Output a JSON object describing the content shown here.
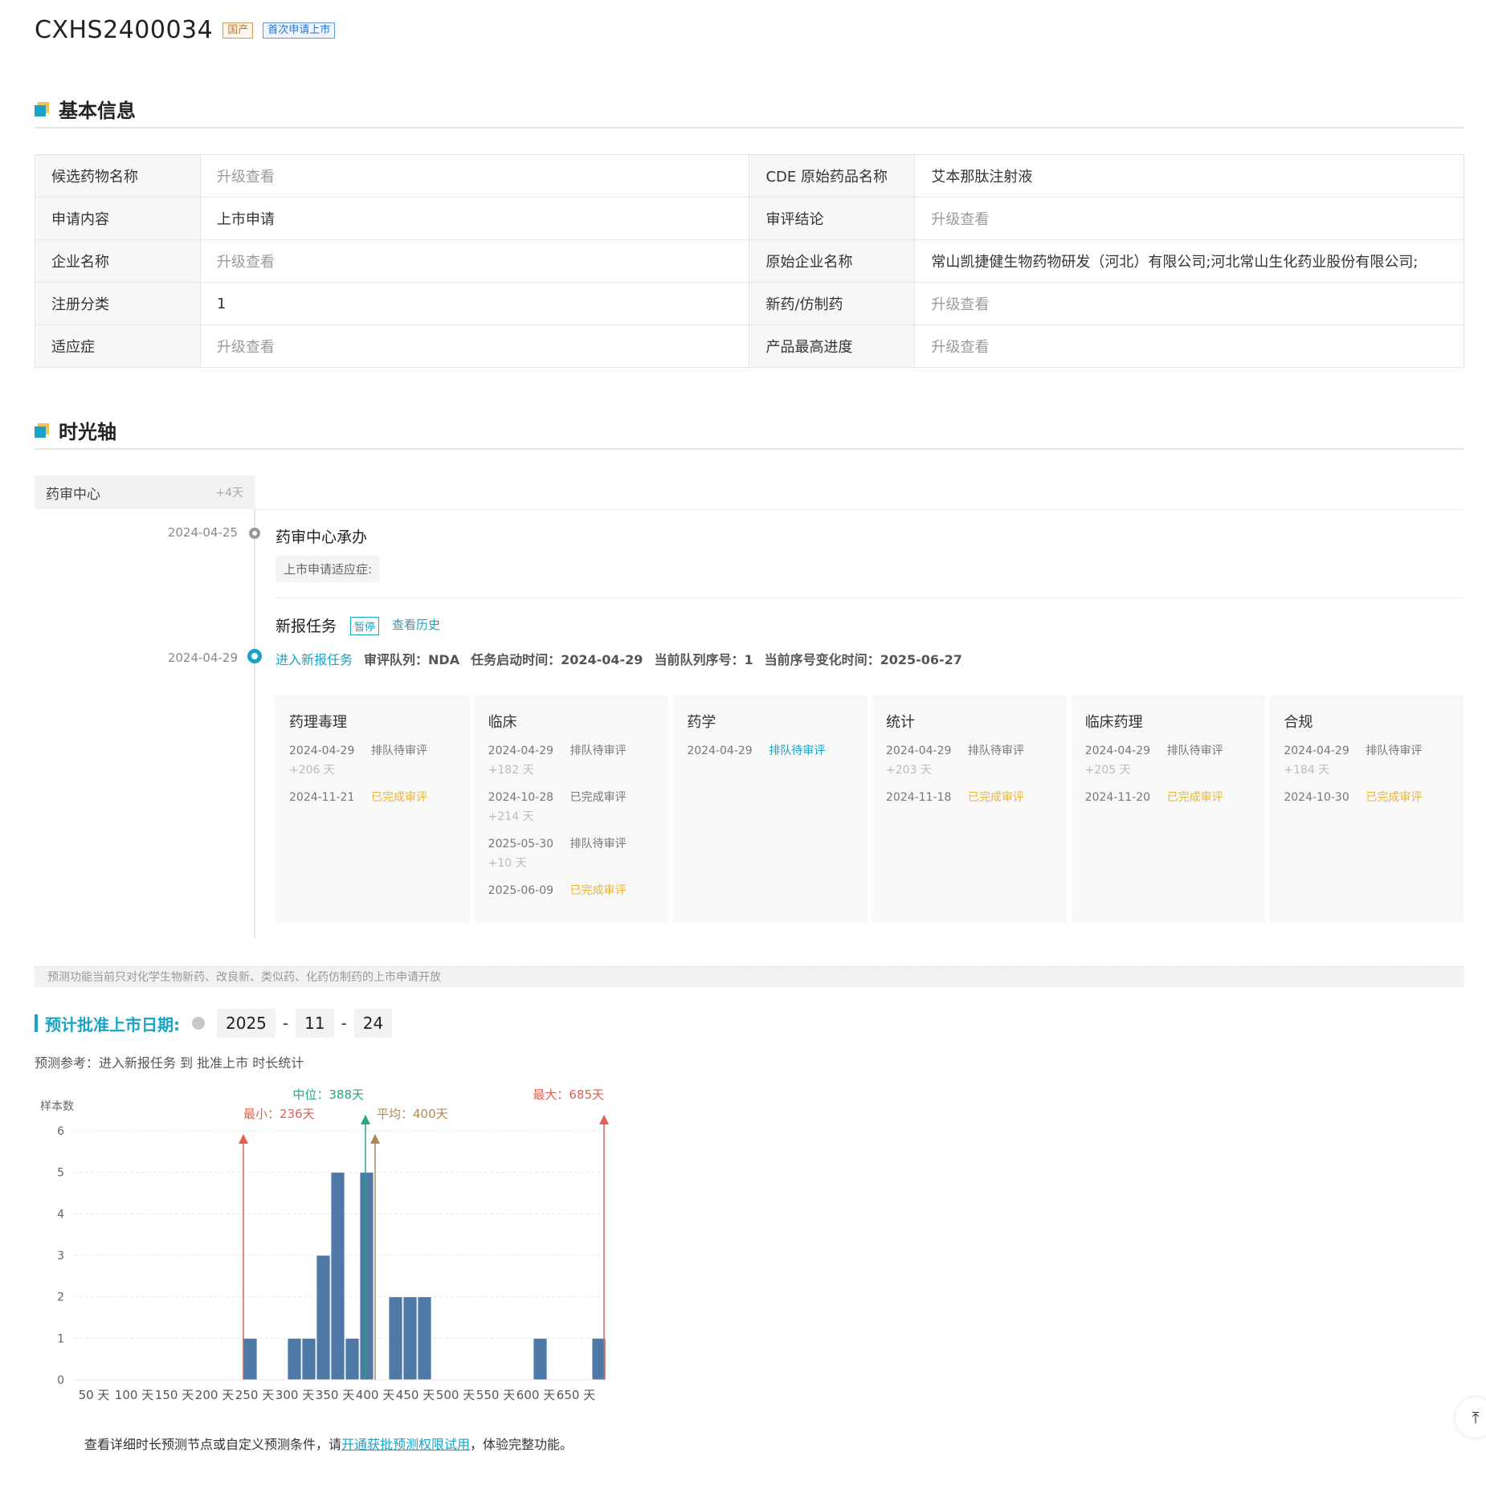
{
  "header": {
    "app_id": "CXHS2400034",
    "tag_origin": "国产",
    "tag_first": "首次申请上市"
  },
  "sections": {
    "basic": "基本信息",
    "timeline": "时光轴"
  },
  "info_table": {
    "rows": [
      {
        "l1": "候选药物名称",
        "v1": "升级查看",
        "l2": "CDE 原始药品名称",
        "v2": "艾本那肽注射液"
      },
      {
        "l1": "申请内容",
        "v1": "上市申请",
        "l2": "审评结论",
        "v2": "升级查看"
      },
      {
        "l1": "企业名称",
        "v1": "升级查看",
        "l2": "原始企业名称",
        "v2": "常山凯捷健生物药物研发（河北）有限公司;河北常山生化药业股份有限公司;"
      },
      {
        "l1": "注册分类",
        "v1": "1",
        "l2": "新药/仿制药",
        "v2": "升级查看"
      },
      {
        "l1": "适应症",
        "v1": "升级查看",
        "l2": "产品最高进度",
        "v2": "升级查看"
      }
    ]
  },
  "timeline": {
    "org": "药审中心",
    "org_days": "+4天",
    "event1": {
      "date": "2024-04-25",
      "title": "药审中心承办",
      "indication": "上市申请适应症:"
    },
    "event2": {
      "date": "2024-04-29",
      "title": "新报任务",
      "badge": "暂停",
      "history_link": "查看历史",
      "enter": "进入新报任务",
      "queue": "审评队列：NDA",
      "start": "任务启动时间：2024-04-29",
      "seq": "当前队列序号：1",
      "seq_change": "当前序号变化时间：2025-06-27"
    },
    "cards": [
      {
        "title": "药理毒理",
        "entries": [
          {
            "date": "2024-04-29",
            "status": "排队待审评",
            "kind": "q",
            "plus": "+206 天"
          },
          {
            "date": "2024-11-21",
            "status": "已完成审评",
            "kind": "done",
            "plus": ""
          }
        ]
      },
      {
        "title": "临床",
        "entries": [
          {
            "date": "2024-04-29",
            "status": "排队待审评",
            "kind": "q",
            "plus": "+182 天"
          },
          {
            "date": "2024-10-28",
            "status": "已完成审评",
            "kind": "q",
            "plus": "+214 天"
          },
          {
            "date": "2025-05-30",
            "status": "排队待审评",
            "kind": "q",
            "plus": "+10 天"
          },
          {
            "date": "2025-06-09",
            "status": "已完成审评",
            "kind": "done",
            "plus": ""
          }
        ]
      },
      {
        "title": "药学",
        "entries": [
          {
            "date": "2024-04-29",
            "status": "排队待审评",
            "kind": "qblue",
            "plus": ""
          }
        ]
      },
      {
        "title": "统计",
        "entries": [
          {
            "date": "2024-04-29",
            "status": "排队待审评",
            "kind": "q",
            "plus": "+203 天"
          },
          {
            "date": "2024-11-18",
            "status": "已完成审评",
            "kind": "done",
            "plus": ""
          }
        ]
      },
      {
        "title": "临床药理",
        "entries": [
          {
            "date": "2024-04-29",
            "status": "排队待审评",
            "kind": "q",
            "plus": "+205 天"
          },
          {
            "date": "2024-11-20",
            "status": "已完成审评",
            "kind": "done",
            "plus": ""
          }
        ]
      },
      {
        "title": "合规",
        "entries": [
          {
            "date": "2024-04-29",
            "status": "排队待审评",
            "kind": "q",
            "plus": "+184 天"
          },
          {
            "date": "2024-10-30",
            "status": "已完成审评",
            "kind": "done",
            "plus": ""
          }
        ]
      }
    ]
  },
  "notice": "预测功能当前只对化学生物新药、改良新、类似药、化药仿制药的上市申请开放",
  "prediction": {
    "label": "预计批准上市日期:",
    "year": "2025",
    "month": "11",
    "day": "24",
    "sep": "-",
    "reference": "预测参考：进入新报任务 到 批准上市 时长统计"
  },
  "chart_data": {
    "type": "bar",
    "ylabel": "样本数",
    "ylim": [
      0,
      6
    ],
    "yticks": [
      0,
      1,
      2,
      3,
      4,
      5,
      6
    ],
    "xlim": [
      25,
      685
    ],
    "xticks": [
      50,
      100,
      150,
      200,
      250,
      300,
      350,
      400,
      450,
      500,
      550,
      600,
      650
    ],
    "xtick_suffix": " 天",
    "bin_width": 18,
    "bars": [
      {
        "x": 245,
        "value": 1
      },
      {
        "x": 300,
        "value": 1
      },
      {
        "x": 318,
        "value": 1
      },
      {
        "x": 336,
        "value": 3
      },
      {
        "x": 354,
        "value": 5
      },
      {
        "x": 372,
        "value": 1
      },
      {
        "x": 390,
        "value": 5
      },
      {
        "x": 426,
        "value": 2
      },
      {
        "x": 444,
        "value": 2
      },
      {
        "x": 462,
        "value": 2
      },
      {
        "x": 606,
        "value": 1
      },
      {
        "x": 679,
        "value": 1
      }
    ],
    "markers": [
      {
        "name": "最小",
        "value": 236,
        "label": "最小：236天",
        "color": "#e06050"
      },
      {
        "name": "中位",
        "value": 388,
        "label": "中位：388天",
        "color": "#2aa676"
      },
      {
        "name": "平均",
        "value": 400,
        "label": "平均：400天",
        "color": "#b08850"
      },
      {
        "name": "最大",
        "value": 685,
        "label": "最大：685天",
        "color": "#e06050"
      }
    ],
    "bar_color": "#4e79a7"
  },
  "footer": {
    "pre": "查看详细时长预测节点或自定义预测条件，请",
    "link": "开通获批预测权限试用",
    "post": "，体验完整功能。"
  },
  "backtop_icon": "arrow-up-to-line-icon"
}
